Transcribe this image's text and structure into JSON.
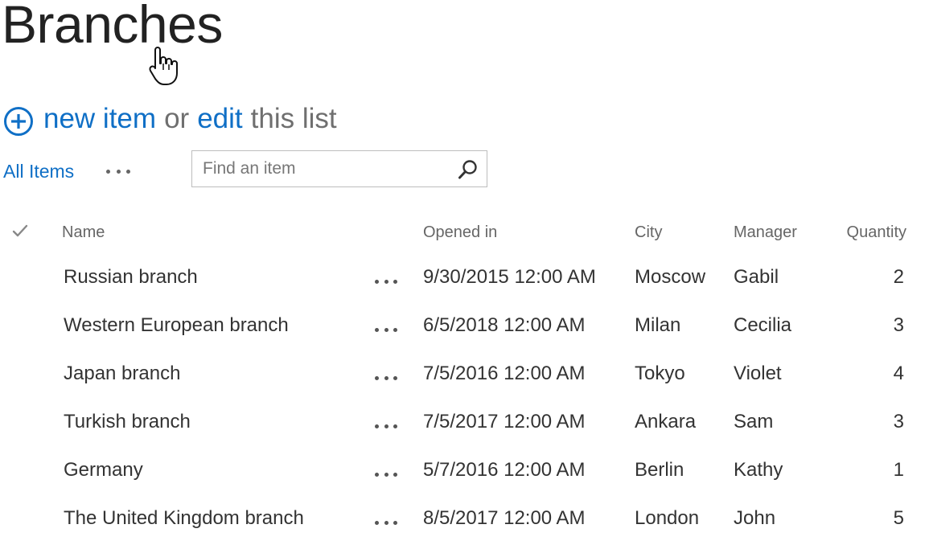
{
  "page": {
    "title": "Branches"
  },
  "actions": {
    "new_item": "new item",
    "or": "or",
    "edit": "edit",
    "this_list": "this list"
  },
  "view": {
    "current": "All Items"
  },
  "search": {
    "placeholder": "Find an item"
  },
  "table": {
    "headers": {
      "name": "Name",
      "opened_in": "Opened in",
      "city": "City",
      "manager": "Manager",
      "quantity": "Quantity"
    },
    "rows": [
      {
        "name": "Russian branch",
        "opened_in": "9/30/2015 12:00 AM",
        "city": "Moscow",
        "manager": "Gabil",
        "quantity": "2"
      },
      {
        "name": "Western European branch",
        "opened_in": "6/5/2018 12:00 AM",
        "city": "Milan",
        "manager": "Cecilia",
        "quantity": "3"
      },
      {
        "name": "Japan branch",
        "opened_in": "7/5/2016 12:00 AM",
        "city": "Tokyo",
        "manager": "Violet",
        "quantity": "4"
      },
      {
        "name": "Turkish branch",
        "opened_in": "7/5/2017 12:00 AM",
        "city": "Ankara",
        "manager": "Sam",
        "quantity": "3"
      },
      {
        "name": "Germany",
        "opened_in": "5/7/2016 12:00 AM",
        "city": "Berlin",
        "manager": "Kathy",
        "quantity": "1"
      },
      {
        "name": "The United Kingdom branch",
        "opened_in": "8/5/2017 12:00 AM",
        "city": "London",
        "manager": "John",
        "quantity": "5"
      }
    ]
  },
  "icons": {
    "add": "plus-circle-icon",
    "search": "magnifier-icon",
    "select_all": "checkmark-icon",
    "more": "ellipsis-icon",
    "cursor": "hand-pointer-icon"
  },
  "colors": {
    "accent": "#0f6fc6",
    "muted_text": "#6f6f6f",
    "body_text": "#333333",
    "border": "#bdbdbd"
  }
}
